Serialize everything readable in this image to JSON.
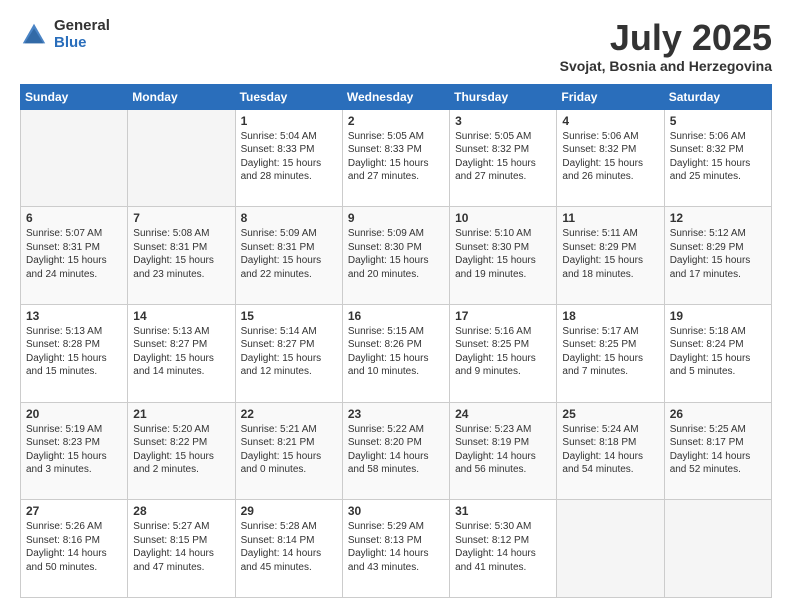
{
  "header": {
    "logo_general": "General",
    "logo_blue": "Blue",
    "month_title": "July 2025",
    "location": "Svojat, Bosnia and Herzegovina"
  },
  "weekdays": [
    "Sunday",
    "Monday",
    "Tuesday",
    "Wednesday",
    "Thursday",
    "Friday",
    "Saturday"
  ],
  "weeks": [
    [
      {
        "day": "",
        "text": ""
      },
      {
        "day": "",
        "text": ""
      },
      {
        "day": "1",
        "text": "Sunrise: 5:04 AM\nSunset: 8:33 PM\nDaylight: 15 hours and 28 minutes."
      },
      {
        "day": "2",
        "text": "Sunrise: 5:05 AM\nSunset: 8:33 PM\nDaylight: 15 hours and 27 minutes."
      },
      {
        "day": "3",
        "text": "Sunrise: 5:05 AM\nSunset: 8:32 PM\nDaylight: 15 hours and 27 minutes."
      },
      {
        "day": "4",
        "text": "Sunrise: 5:06 AM\nSunset: 8:32 PM\nDaylight: 15 hours and 26 minutes."
      },
      {
        "day": "5",
        "text": "Sunrise: 5:06 AM\nSunset: 8:32 PM\nDaylight: 15 hours and 25 minutes."
      }
    ],
    [
      {
        "day": "6",
        "text": "Sunrise: 5:07 AM\nSunset: 8:31 PM\nDaylight: 15 hours and 24 minutes."
      },
      {
        "day": "7",
        "text": "Sunrise: 5:08 AM\nSunset: 8:31 PM\nDaylight: 15 hours and 23 minutes."
      },
      {
        "day": "8",
        "text": "Sunrise: 5:09 AM\nSunset: 8:31 PM\nDaylight: 15 hours and 22 minutes."
      },
      {
        "day": "9",
        "text": "Sunrise: 5:09 AM\nSunset: 8:30 PM\nDaylight: 15 hours and 20 minutes."
      },
      {
        "day": "10",
        "text": "Sunrise: 5:10 AM\nSunset: 8:30 PM\nDaylight: 15 hours and 19 minutes."
      },
      {
        "day": "11",
        "text": "Sunrise: 5:11 AM\nSunset: 8:29 PM\nDaylight: 15 hours and 18 minutes."
      },
      {
        "day": "12",
        "text": "Sunrise: 5:12 AM\nSunset: 8:29 PM\nDaylight: 15 hours and 17 minutes."
      }
    ],
    [
      {
        "day": "13",
        "text": "Sunrise: 5:13 AM\nSunset: 8:28 PM\nDaylight: 15 hours and 15 minutes."
      },
      {
        "day": "14",
        "text": "Sunrise: 5:13 AM\nSunset: 8:27 PM\nDaylight: 15 hours and 14 minutes."
      },
      {
        "day": "15",
        "text": "Sunrise: 5:14 AM\nSunset: 8:27 PM\nDaylight: 15 hours and 12 minutes."
      },
      {
        "day": "16",
        "text": "Sunrise: 5:15 AM\nSunset: 8:26 PM\nDaylight: 15 hours and 10 minutes."
      },
      {
        "day": "17",
        "text": "Sunrise: 5:16 AM\nSunset: 8:25 PM\nDaylight: 15 hours and 9 minutes."
      },
      {
        "day": "18",
        "text": "Sunrise: 5:17 AM\nSunset: 8:25 PM\nDaylight: 15 hours and 7 minutes."
      },
      {
        "day": "19",
        "text": "Sunrise: 5:18 AM\nSunset: 8:24 PM\nDaylight: 15 hours and 5 minutes."
      }
    ],
    [
      {
        "day": "20",
        "text": "Sunrise: 5:19 AM\nSunset: 8:23 PM\nDaylight: 15 hours and 3 minutes."
      },
      {
        "day": "21",
        "text": "Sunrise: 5:20 AM\nSunset: 8:22 PM\nDaylight: 15 hours and 2 minutes."
      },
      {
        "day": "22",
        "text": "Sunrise: 5:21 AM\nSunset: 8:21 PM\nDaylight: 15 hours and 0 minutes."
      },
      {
        "day": "23",
        "text": "Sunrise: 5:22 AM\nSunset: 8:20 PM\nDaylight: 14 hours and 58 minutes."
      },
      {
        "day": "24",
        "text": "Sunrise: 5:23 AM\nSunset: 8:19 PM\nDaylight: 14 hours and 56 minutes."
      },
      {
        "day": "25",
        "text": "Sunrise: 5:24 AM\nSunset: 8:18 PM\nDaylight: 14 hours and 54 minutes."
      },
      {
        "day": "26",
        "text": "Sunrise: 5:25 AM\nSunset: 8:17 PM\nDaylight: 14 hours and 52 minutes."
      }
    ],
    [
      {
        "day": "27",
        "text": "Sunrise: 5:26 AM\nSunset: 8:16 PM\nDaylight: 14 hours and 50 minutes."
      },
      {
        "day": "28",
        "text": "Sunrise: 5:27 AM\nSunset: 8:15 PM\nDaylight: 14 hours and 47 minutes."
      },
      {
        "day": "29",
        "text": "Sunrise: 5:28 AM\nSunset: 8:14 PM\nDaylight: 14 hours and 45 minutes."
      },
      {
        "day": "30",
        "text": "Sunrise: 5:29 AM\nSunset: 8:13 PM\nDaylight: 14 hours and 43 minutes."
      },
      {
        "day": "31",
        "text": "Sunrise: 5:30 AM\nSunset: 8:12 PM\nDaylight: 14 hours and 41 minutes."
      },
      {
        "day": "",
        "text": ""
      },
      {
        "day": "",
        "text": ""
      }
    ]
  ]
}
